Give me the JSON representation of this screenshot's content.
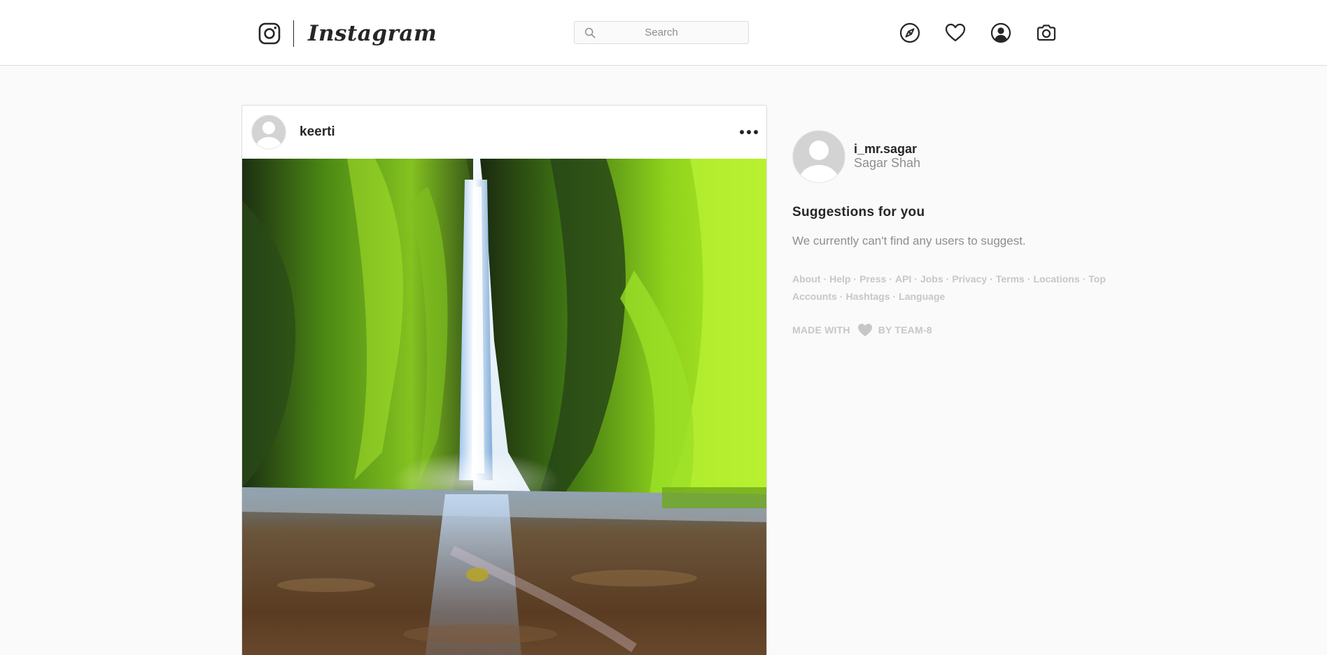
{
  "header": {
    "brand_text": "Instagram",
    "search": {
      "placeholder": "Search",
      "value": ""
    },
    "nav_icons": [
      "explore-compass-icon",
      "activity-heart-icon",
      "profile-icon",
      "camera-icon"
    ]
  },
  "post": {
    "username": "keerti",
    "more_icon": "more-options-icon",
    "photo_subject": "waterfall-gorge-photo"
  },
  "sidebar": {
    "user_handle": "i_mr.sagar",
    "user_full_name": "Sagar Shah",
    "suggestions_title": "Suggestions for you",
    "suggestions_empty": "We currently can't find any users to suggest.",
    "footer_links": [
      "About",
      "Help",
      "Press",
      "API",
      "Jobs",
      "Privacy",
      "Terms",
      "Locations",
      "Top Accounts",
      "Hashtags",
      "Language"
    ],
    "made_with_prefix": "MADE WITH",
    "made_with_suffix": "BY TEAM-8"
  },
  "colors": {
    "text_primary": "#262626",
    "text_secondary": "#8e8e8e",
    "text_muted": "#c7c7c7",
    "border": "#dbdbdb",
    "background": "#fafafa"
  }
}
